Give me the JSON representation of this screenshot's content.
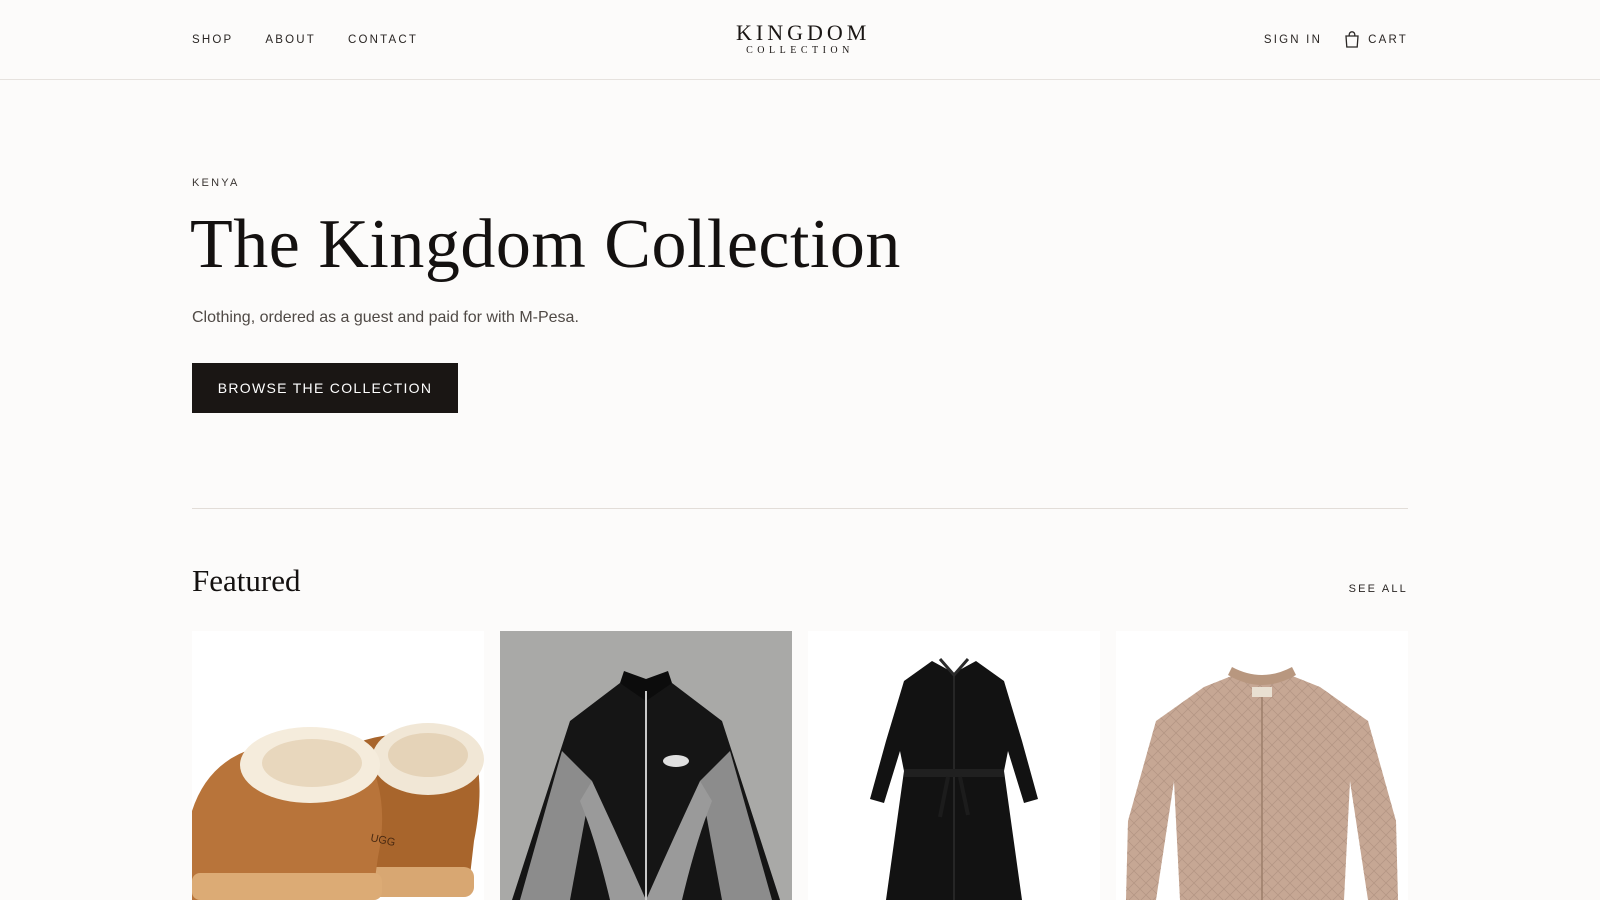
{
  "nav": {
    "left": [
      "SHOP",
      "ABOUT",
      "CONTACT"
    ],
    "sign_in": "SIGN IN",
    "cart": "CART",
    "cart_icon": "shopping-bag-icon"
  },
  "logo": {
    "main": "KINGDOM",
    "sub": "COLLECTION"
  },
  "hero": {
    "eyebrow": "KENYA",
    "title": "The Kingdom Collection",
    "subtitle": "Clothing, ordered as a guest and paid for with M-Pesa.",
    "cta": "BROWSE THE COLLECTION"
  },
  "featured": {
    "title": "Featured",
    "see_all": "SEE ALL",
    "products": [
      {
        "image": "chestnut-platform-slippers",
        "brand_mark": "UGG"
      },
      {
        "image": "black-grey-track-jacket"
      },
      {
        "image": "black-shirt-dress"
      },
      {
        "image": "beige-quilted-bomber-jacket"
      }
    ]
  },
  "colors": {
    "background": "#fcfbfa",
    "text": "#1a1614",
    "button": "#1a1614",
    "divider": "#e2ddd8"
  }
}
